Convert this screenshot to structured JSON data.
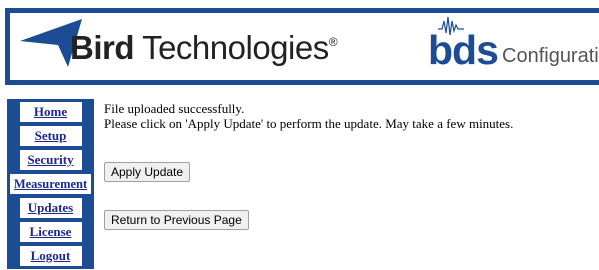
{
  "header": {
    "brand_bold": "Bird",
    "brand_rest": " Technologies",
    "brand_reg": "®",
    "bds_logo_text": "bds",
    "config_label": "Configuration",
    "accent_color": "#1c4d94"
  },
  "nav": {
    "items": [
      {
        "label": "Home"
      },
      {
        "label": "Setup"
      },
      {
        "label": "Security"
      },
      {
        "label": "Measurement"
      },
      {
        "label": "Updates"
      },
      {
        "label": "License"
      },
      {
        "label": "Logout"
      }
    ]
  },
  "main": {
    "message_line1": "File uploaded successfully.",
    "message_line2": "Please click on 'Apply Update' to perform the update. May take a few minutes.",
    "apply_button": "Apply Update",
    "return_button": "Return to Previous Page"
  }
}
